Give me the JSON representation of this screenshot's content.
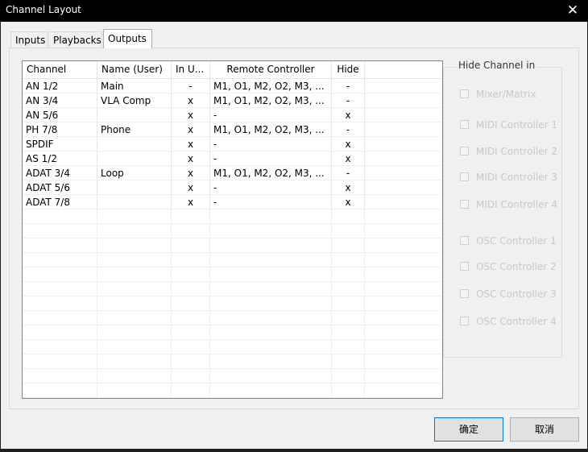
{
  "window": {
    "title": "Channel Layout",
    "close_glyph": "✕"
  },
  "tabs": [
    {
      "label": "Inputs"
    },
    {
      "label": "Playbacks"
    },
    {
      "label": "Outputs"
    }
  ],
  "table": {
    "headers": [
      "Channel",
      "Name (User)",
      "In U...",
      "Remote Controller",
      "Hide"
    ],
    "rows": [
      [
        "AN 1/2",
        "Main",
        "-",
        "M1, O1, M2, O2, M3, ...",
        "-"
      ],
      [
        "AN 3/4",
        "VLA Comp",
        "x",
        "M1, O1, M2, O2, M3, ...",
        "-"
      ],
      [
        "AN 5/6",
        "",
        "x",
        "-",
        "x"
      ],
      [
        "PH 7/8",
        "Phone",
        "x",
        "M1, O1, M2, O2, M3, ...",
        "-"
      ],
      [
        "SPDIF",
        "",
        "x",
        "-",
        "x"
      ],
      [
        "AS 1/2",
        "",
        "x",
        "-",
        "x"
      ],
      [
        "ADAT 3/4",
        "Loop",
        "x",
        "M1, O1, M2, O2, M3, ...",
        "-"
      ],
      [
        "ADAT 5/6",
        "",
        "x",
        "-",
        "x"
      ],
      [
        "ADAT 7/8",
        "",
        "x",
        "-",
        "x"
      ]
    ]
  },
  "hide_group": {
    "label": "Hide Channel in",
    "options": [
      "Mixer/Matrix",
      "MIDI Controller 1",
      "MIDI Controller 2",
      "MIDI Controller 3",
      "MIDI Controller 4",
      "OSC Controller 1",
      "OSC Controller 2",
      "OSC Controller 3",
      "OSC Controller 4"
    ]
  },
  "buttons": {
    "ok": "确定",
    "cancel": "取消"
  }
}
